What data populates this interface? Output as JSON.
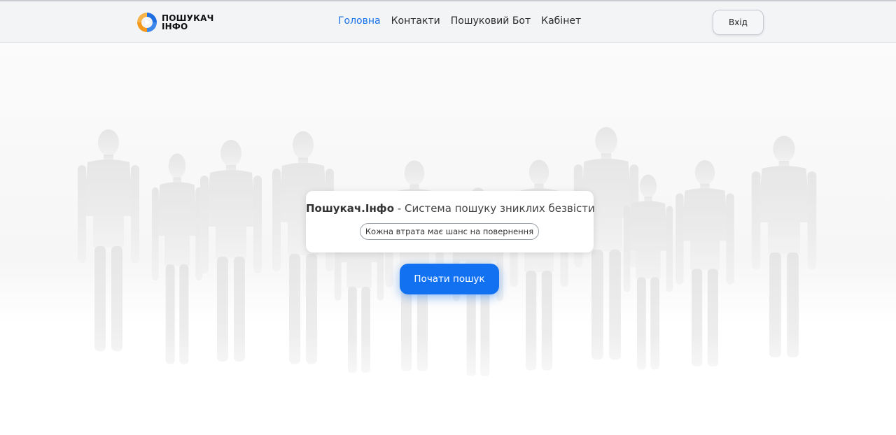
{
  "header": {
    "logo": {
      "line1": "ПОШУКАЧ",
      "line2": "ІНФО",
      "icon": "logo-arrows-icon",
      "colors": {
        "blue": "#1f6fe0",
        "orange": "#f39a1e"
      }
    },
    "nav": [
      {
        "label": "Головна",
        "active": true
      },
      {
        "label": "Контакти",
        "active": false
      },
      {
        "label": "Пошуковий Бот",
        "active": false
      },
      {
        "label": "Кабінет",
        "active": false
      }
    ],
    "login_label": "Вхід"
  },
  "hero": {
    "brand": "Пошукач.Інфо",
    "separator": "-",
    "title_rest": "Система пошуку зниклих безвісти",
    "tagline": "Кожна втрата має шанс на повернення",
    "cta_label": "Почати пошук",
    "background": "crowd-silhouettes-image"
  },
  "colors": {
    "accent": "#1271f0",
    "nav_active": "#1a73e8",
    "header_bg": "#f3f4f6"
  }
}
